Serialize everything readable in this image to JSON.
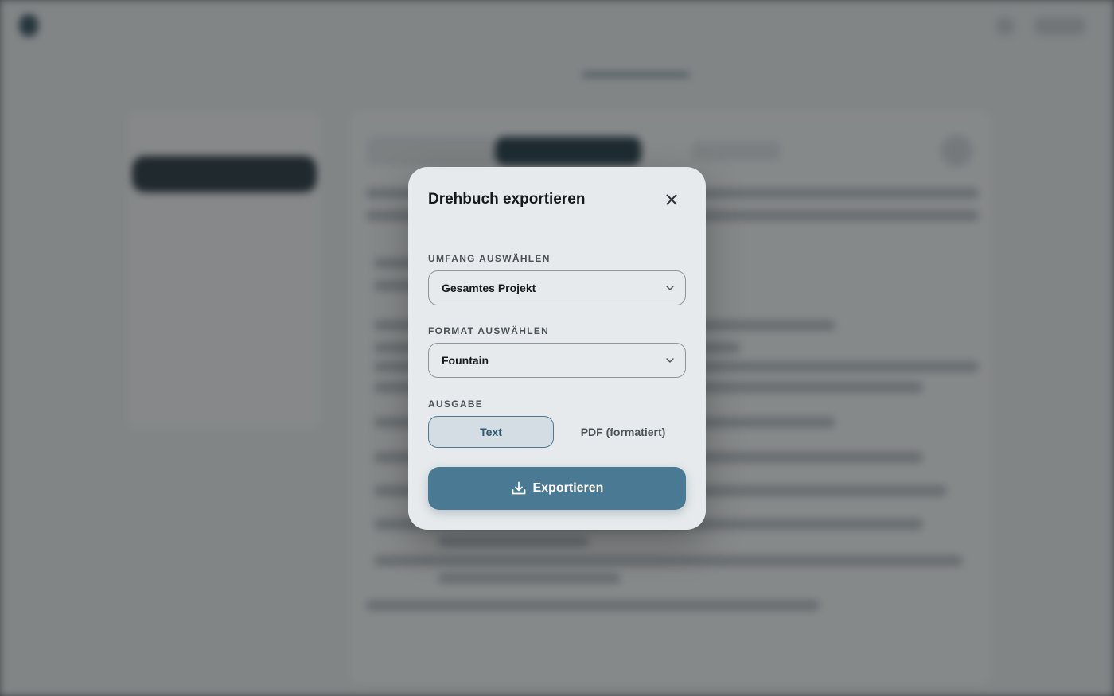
{
  "modal": {
    "title": "Drehbuch exportieren",
    "scope": {
      "label": "UMFANG AUSWÄHLEN",
      "value": "Gesamtes Projekt"
    },
    "format": {
      "label": "FORMAT AUSWÄHLEN",
      "value": "Fountain"
    },
    "output": {
      "label": "AUSGABE",
      "options": [
        {
          "label": "Text",
          "selected": true
        },
        {
          "label": "PDF (formatiert)",
          "selected": false
        }
      ]
    },
    "export_label": "Exportieren"
  },
  "icons": {
    "close": "close-icon",
    "dropdown": "chevron-down-icon",
    "export": "download-icon"
  },
  "colors": {
    "accent": "#4a7a93",
    "modal_bg": "#e6eaec",
    "selected_bg": "#d3dde3"
  }
}
